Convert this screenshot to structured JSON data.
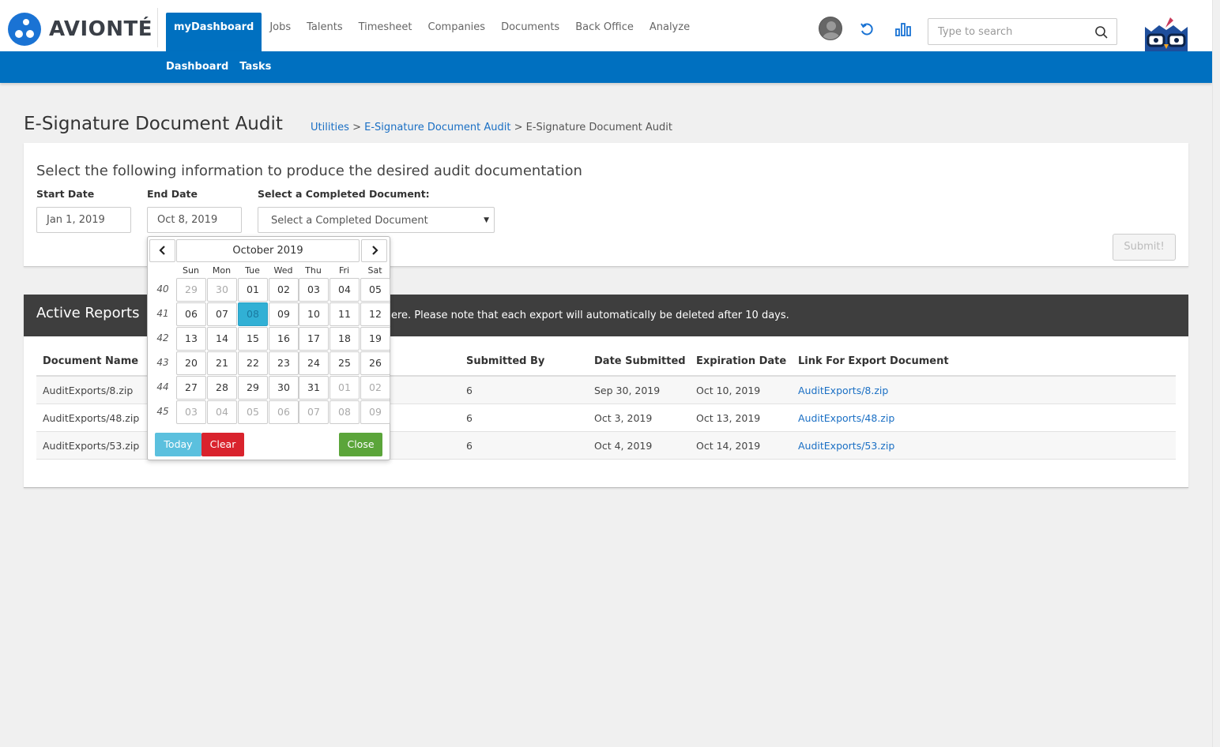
{
  "brand": {
    "name": "AVIONTÉ",
    "accent": "#0070c0"
  },
  "nav": {
    "items": [
      {
        "label": "myDashboard",
        "active": true
      },
      {
        "label": "Jobs"
      },
      {
        "label": "Talents"
      },
      {
        "label": "Timesheet"
      },
      {
        "label": "Companies"
      },
      {
        "label": "Documents"
      },
      {
        "label": "Back Office"
      },
      {
        "label": "Analyze"
      }
    ],
    "sub_items": [
      {
        "label": "Dashboard"
      },
      {
        "label": "Tasks"
      }
    ]
  },
  "search": {
    "placeholder": "Type to search"
  },
  "page": {
    "title": "E-Signature Document Audit",
    "breadcrumb": [
      {
        "label": "Utilities",
        "link": true
      },
      {
        "label": "E-Signature Document Audit",
        "link": true
      },
      {
        "label": "E-Signature Document Audit",
        "link": false
      }
    ],
    "separator": ">"
  },
  "form": {
    "heading": "Select the following information to produce the desired audit documentation",
    "start_label": "Start Date",
    "start_value": "Jan 1, 2019",
    "end_label": "End Date",
    "end_value": "Oct 8, 2019",
    "doc_label": "Select a Completed Document:",
    "doc_value": "Select a Completed Document",
    "submit_label": "Submit!"
  },
  "reports": {
    "title": "Active Reports",
    "note": "ere. Please note that each export will automatically be deleted after 10 days.",
    "columns": [
      "Document Name",
      "Submitted By",
      "Date Submitted",
      "Expiration Date",
      "Link For Export Document"
    ],
    "rows": [
      {
        "name": "AuditExports/8.zip",
        "by": "6",
        "submitted": "Sep 30, 2019",
        "expires": "Oct 10, 2019",
        "link": "AuditExports/8.zip"
      },
      {
        "name": "AuditExports/48.zip",
        "by": "6",
        "submitted": "Oct 3, 2019",
        "expires": "Oct 13, 2019",
        "link": "AuditExports/48.zip"
      },
      {
        "name": "AuditExports/53.zip",
        "by": "6",
        "submitted": "Oct 4, 2019",
        "expires": "Oct 14, 2019",
        "link": "AuditExports/53.zip"
      }
    ]
  },
  "datepicker": {
    "month_label": "October 2019",
    "prev_icon": "chevron-left-icon",
    "next_icon": "chevron-right-icon",
    "days_of_week": [
      "Sun",
      "Mon",
      "Tue",
      "Wed",
      "Thu",
      "Fri",
      "Sat"
    ],
    "weeks": [
      {
        "number": "40",
        "days": [
          {
            "d": "29",
            "m": true
          },
          {
            "d": "30",
            "m": true
          },
          {
            "d": "01"
          },
          {
            "d": "02"
          },
          {
            "d": "03"
          },
          {
            "d": "04"
          },
          {
            "d": "05"
          }
        ]
      },
      {
        "number": "41",
        "days": [
          {
            "d": "06"
          },
          {
            "d": "07"
          },
          {
            "d": "08",
            "sel": true
          },
          {
            "d": "09"
          },
          {
            "d": "10"
          },
          {
            "d": "11"
          },
          {
            "d": "12"
          }
        ]
      },
      {
        "number": "42",
        "days": [
          {
            "d": "13"
          },
          {
            "d": "14"
          },
          {
            "d": "15"
          },
          {
            "d": "16"
          },
          {
            "d": "17"
          },
          {
            "d": "18"
          },
          {
            "d": "19"
          }
        ]
      },
      {
        "number": "43",
        "days": [
          {
            "d": "20"
          },
          {
            "d": "21"
          },
          {
            "d": "22"
          },
          {
            "d": "23"
          },
          {
            "d": "24"
          },
          {
            "d": "25"
          },
          {
            "d": "26"
          }
        ]
      },
      {
        "number": "44",
        "days": [
          {
            "d": "27"
          },
          {
            "d": "28"
          },
          {
            "d": "29"
          },
          {
            "d": "30"
          },
          {
            "d": "31"
          },
          {
            "d": "01",
            "m": true
          },
          {
            "d": "02",
            "m": true
          }
        ]
      },
      {
        "number": "45",
        "days": [
          {
            "d": "03",
            "m": true
          },
          {
            "d": "04",
            "m": true
          },
          {
            "d": "05",
            "m": true
          },
          {
            "d": "06",
            "m": true
          },
          {
            "d": "07",
            "m": true
          },
          {
            "d": "08",
            "m": true
          },
          {
            "d": "09",
            "m": true
          }
        ]
      }
    ],
    "today_label": "Today",
    "clear_label": "Clear",
    "close_label": "Close",
    "colors": {
      "today": "#5bc0de",
      "clear": "#d9232d",
      "close": "#5ba53a",
      "selected": "#31b0d5"
    }
  }
}
